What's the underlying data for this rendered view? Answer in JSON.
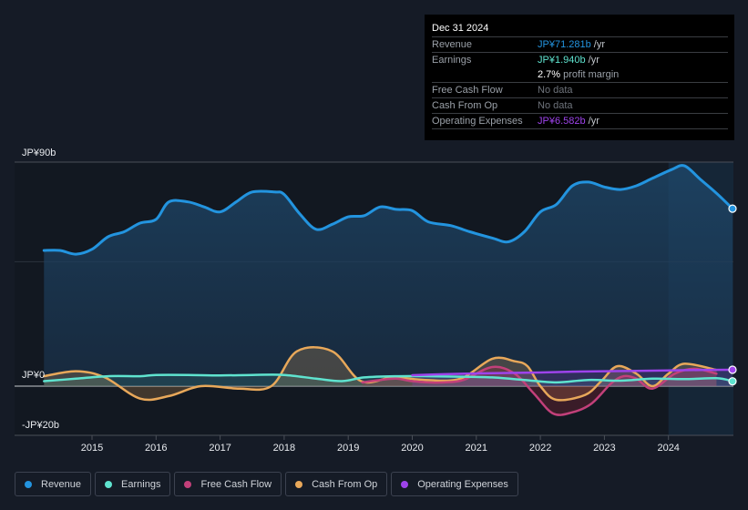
{
  "tooltip": {
    "date": "Dec 31 2024",
    "rows": [
      {
        "label": "Revenue",
        "value": "JP¥71.281b",
        "unit": " /yr",
        "color": "#2394df"
      },
      {
        "label": "Earnings",
        "value": "JP¥1.940b",
        "unit": " /yr",
        "color": "#5fe3cf"
      },
      {
        "label": "",
        "value": "2.7%",
        "unit": " profit margin",
        "color": "#ffffff"
      },
      {
        "label": "Free Cash Flow",
        "value": "No data"
      },
      {
        "label": "Cash From Op",
        "value": "No data"
      },
      {
        "label": "Operating Expenses",
        "value": "JP¥6.582b",
        "unit": " /yr",
        "color": "#9e43eb"
      }
    ]
  },
  "legend": [
    {
      "label": "Revenue",
      "color": "#2394df"
    },
    {
      "label": "Earnings",
      "color": "#5fe3cf"
    },
    {
      "label": "Free Cash Flow",
      "color": "#c2407a"
    },
    {
      "label": "Cash From Op",
      "color": "#e8a85a"
    },
    {
      "label": "Operating Expenses",
      "color": "#9e43eb"
    }
  ],
  "chart_data": {
    "type": "area",
    "title": "",
    "xlabel": "",
    "ylabel": "",
    "currency_unit": "JP¥ billions",
    "ylim": [
      -20,
      90
    ],
    "xlim": [
      2014.25,
      2025.0
    ],
    "y_tick_labels": [
      {
        "value": 90,
        "label": "JP¥90b"
      },
      {
        "value": 0,
        "label": "JP¥0"
      },
      {
        "value": -20,
        "label": "-JP¥20b"
      }
    ],
    "gridlines": [
      90,
      50,
      0
    ],
    "x_ticks": [
      2015,
      2016,
      2017,
      2018,
      2019,
      2020,
      2021,
      2022,
      2023,
      2024
    ],
    "highlight_from": 2024.0,
    "legend_position": "bottom-left",
    "series": [
      {
        "name": "Revenue",
        "color": "#2394df",
        "x": [
          2014.25,
          2014.5,
          2014.75,
          2015.0,
          2015.25,
          2015.5,
          2015.75,
          2016.0,
          2016.2,
          2016.5,
          2016.75,
          2017.0,
          2017.25,
          2017.5,
          2017.85,
          2018.0,
          2018.25,
          2018.5,
          2018.75,
          2019.0,
          2019.25,
          2019.5,
          2019.75,
          2020.0,
          2020.25,
          2020.6,
          2020.9,
          2021.25,
          2021.5,
          2021.75,
          2022.0,
          2022.25,
          2022.5,
          2022.75,
          2023.0,
          2023.25,
          2023.5,
          2023.75,
          2024.05,
          2024.25,
          2024.5,
          2024.75,
          2025.0
        ],
        "values": [
          54.5,
          54.5,
          53,
          55,
          60,
          62,
          65.5,
          67,
          74,
          74,
          72,
          70,
          74,
          78,
          78,
          77,
          69,
          63,
          65,
          68,
          68.5,
          72,
          71,
          70.5,
          66,
          64.5,
          62,
          59.5,
          58,
          62,
          70,
          73,
          80.5,
          82,
          80,
          79,
          80.5,
          83.5,
          87,
          88.5,
          83,
          77.5,
          71.3
        ]
      },
      {
        "name": "Earnings",
        "color": "#5fe3cf",
        "x": [
          2014.25,
          2014.75,
          2015.25,
          2015.75,
          2016.0,
          2016.5,
          2017.0,
          2017.5,
          2018.0,
          2018.5,
          2018.9,
          2019.25,
          2019.75,
          2020.25,
          2020.75,
          2021.25,
          2021.75,
          2022.25,
          2022.75,
          2023.25,
          2023.75,
          2024.25,
          2024.75,
          2025.0
        ],
        "values": [
          2,
          3,
          4,
          4,
          4.5,
          4.5,
          4.3,
          4.5,
          4.5,
          3,
          2,
          3.5,
          4,
          4,
          3.8,
          3.5,
          2.5,
          1.5,
          2.5,
          2.2,
          3,
          2.8,
          3.2,
          1.94
        ]
      },
      {
        "name": "Free Cash Flow",
        "color": "#c2407a",
        "x": [
          2019.22,
          2019.5,
          2019.75,
          2020.0,
          2020.25,
          2020.5,
          2020.8,
          2021.25,
          2021.6,
          2021.9,
          2022.2,
          2022.5,
          2022.8,
          2023.1,
          2023.3,
          2023.5,
          2023.75,
          2024.1,
          2024.4,
          2024.75
        ],
        "values": [
          1.5,
          2.5,
          3,
          2,
          1.5,
          1.5,
          2.5,
          7.7,
          5,
          -3,
          -11,
          -10.5,
          -7,
          1,
          4,
          3,
          -1,
          5,
          7,
          5
        ]
      },
      {
        "name": "Cash From Op",
        "color": "#e8a85a",
        "x": [
          2014.25,
          2014.75,
          2015.2,
          2015.75,
          2016.2,
          2016.7,
          2017.3,
          2017.8,
          2018.2,
          2018.75,
          2019.2,
          2019.7,
          2020.2,
          2020.75,
          2021.25,
          2021.6,
          2021.8,
          2022.0,
          2022.25,
          2022.7,
          2022.95,
          2023.2,
          2023.5,
          2023.75,
          2024.0,
          2024.25,
          2024.75
        ],
        "values": [
          4,
          6,
          3.5,
          -5,
          -4,
          0,
          -1,
          0,
          14,
          14,
          2,
          3.5,
          2.5,
          3,
          11,
          10,
          8,
          0,
          -5.5,
          -3.5,
          2,
          8,
          5,
          0,
          5,
          9,
          6.5
        ]
      },
      {
        "name": "Operating Expenses",
        "color": "#9e43eb",
        "x": [
          2020.0,
          2020.5,
          2021.0,
          2021.5,
          2022.0,
          2022.5,
          2023.0,
          2023.5,
          2024.0,
          2024.5,
          2025.0
        ],
        "values": [
          4.4,
          4.8,
          5.1,
          5.3,
          5.5,
          5.8,
          6.0,
          6.1,
          6.3,
          6.5,
          6.582
        ]
      }
    ]
  }
}
